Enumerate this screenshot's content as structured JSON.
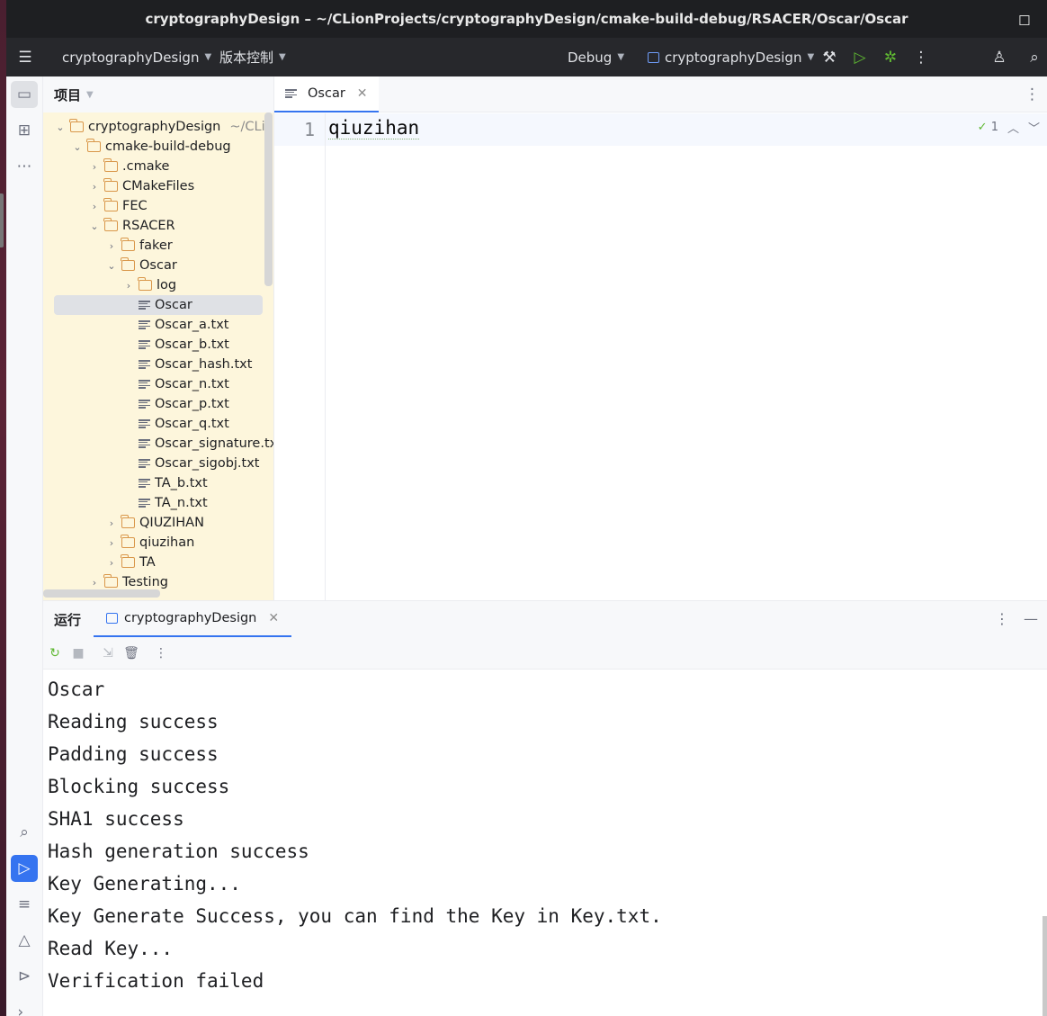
{
  "window": {
    "title": "cryptographyDesign – ~/CLionProjects/cryptographyDesign/cmake-build-debug/RSACER/Oscar/Oscar",
    "close_glyph": "◻"
  },
  "toolbar": {
    "project_name": "cryptographyDesign",
    "vcs_label": "版本控制",
    "build_config": "Debug",
    "run_config": "cryptographyDesign"
  },
  "project_panel": {
    "header": "项目",
    "tree": [
      {
        "label": "cryptographyDesign",
        "hint": "~/CLionP",
        "kind": "folder",
        "expanded": true
      },
      {
        "label": "cmake-build-debug",
        "kind": "folder",
        "expanded": true
      },
      {
        "label": ".cmake",
        "kind": "folder",
        "expanded": false
      },
      {
        "label": "CMakeFiles",
        "kind": "folder",
        "expanded": false
      },
      {
        "label": "FEC",
        "kind": "folder",
        "expanded": false
      },
      {
        "label": "RSACER",
        "kind": "folder",
        "expanded": true
      },
      {
        "label": "faker",
        "kind": "folder",
        "expanded": false
      },
      {
        "label": "Oscar",
        "kind": "folder",
        "expanded": true
      },
      {
        "label": "log",
        "kind": "folder",
        "expanded": false
      },
      {
        "label": "Oscar",
        "kind": "file",
        "selected": true
      },
      {
        "label": "Oscar_a.txt",
        "kind": "file"
      },
      {
        "label": "Oscar_b.txt",
        "kind": "file"
      },
      {
        "label": "Oscar_hash.txt",
        "kind": "file"
      },
      {
        "label": "Oscar_n.txt",
        "kind": "file"
      },
      {
        "label": "Oscar_p.txt",
        "kind": "file"
      },
      {
        "label": "Oscar_q.txt",
        "kind": "file"
      },
      {
        "label": "Oscar_signature.txt",
        "kind": "file"
      },
      {
        "label": "Oscar_sigobj.txt",
        "kind": "file"
      },
      {
        "label": "TA_b.txt",
        "kind": "file"
      },
      {
        "label": "TA_n.txt",
        "kind": "file"
      },
      {
        "label": "QIUZIHAN",
        "kind": "folder",
        "expanded": false
      },
      {
        "label": "qiuzihan",
        "kind": "folder",
        "expanded": false
      },
      {
        "label": "TA",
        "kind": "folder",
        "expanded": false
      },
      {
        "label": "Testing",
        "kind": "folder",
        "expanded": false
      }
    ]
  },
  "editor": {
    "tab_label": "Oscar",
    "line_number": "1",
    "code": "qiuzihan",
    "inspection_count": "1"
  },
  "run_panel": {
    "title": "运行",
    "tab_label": "cryptographyDesign",
    "console_lines": [
      "Oscar",
      "Reading success",
      "Padding success",
      "Blocking success",
      "SHA1 success",
      "Hash generation success",
      "Key Generating...",
      "Key Generate Success, you can find the Key in Key.txt.",
      "Read Key...",
      "Verification failed"
    ]
  },
  "colors": {
    "accent": "#3574f0",
    "project_bg": "#fdf6dc",
    "titlebar": "#1e1f22",
    "toolbar": "#27282c"
  }
}
